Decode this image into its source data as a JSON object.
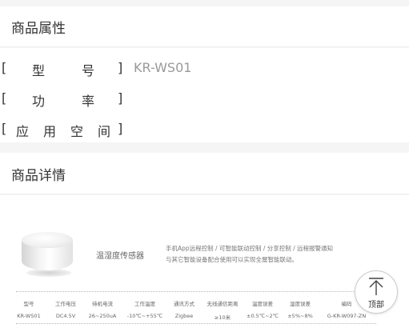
{
  "attributes": {
    "title": "商品属性",
    "rows": [
      {
        "label": [
          "型",
          "号"
        ],
        "value": "KR-WS01"
      },
      {
        "label": [
          "功",
          "率"
        ],
        "value": ""
      },
      {
        "label": [
          "应",
          "用",
          "空",
          "间"
        ],
        "value": ""
      }
    ]
  },
  "details": {
    "title": "商品详情",
    "product_name": "温湿度传感器",
    "description": [
      "手机App远程控制 / 可智能联动控制 / 分享控制 / 远程报警通知",
      "与其它智能设备配合使用可以实现全屋智能联动。"
    ],
    "spec_headers": [
      "型号",
      "工作电压",
      "待机电流",
      "工作温度",
      "通讯方式",
      "无线通信距离",
      "温度误差",
      "湿度误差",
      "编码"
    ],
    "spec_values": [
      "KR-WS01",
      "DC4.5V",
      "26~250uA",
      "-10℃~+55℃",
      "Zigbee",
      "≥10米",
      "±0.5℃~2℃",
      "±5%~8%",
      "G-KR-W097-ZN"
    ]
  },
  "back_to_top": {
    "label": "顶部",
    "icon": "arrow-up-icon"
  }
}
